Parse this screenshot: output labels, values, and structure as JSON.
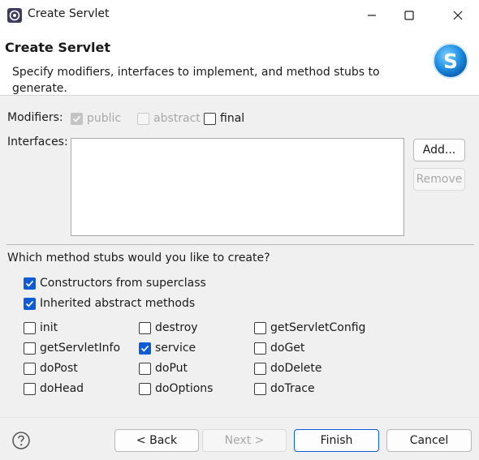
{
  "window": {
    "title": "Create Servlet",
    "icons": {
      "app": "eclipse-icon",
      "minimize": "minimize-icon",
      "maximize": "maximize-icon",
      "close": "close-icon"
    }
  },
  "header": {
    "title": "Create Servlet",
    "description": "Specify modifiers, interfaces to implement, and method stubs to generate.",
    "logo_letter": "S",
    "logo_icon": "servlet-logo-icon"
  },
  "modifiers": {
    "label": "Modifiers:",
    "options": [
      {
        "label": "public",
        "checked": true,
        "enabled": false
      },
      {
        "label": "abstract",
        "checked": false,
        "enabled": false
      },
      {
        "label": "final",
        "checked": false,
        "enabled": true
      }
    ]
  },
  "interfaces": {
    "label": "Interfaces:",
    "items": [],
    "add_label": "Add...",
    "remove_label": "Remove"
  },
  "stubs": {
    "question": "Which method stubs would you like to create?",
    "general": [
      {
        "label": "Constructors from superclass",
        "checked": true
      },
      {
        "label": "Inherited abstract methods",
        "checked": true
      }
    ],
    "methods": [
      {
        "label": "init",
        "checked": false
      },
      {
        "label": "destroy",
        "checked": false
      },
      {
        "label": "getServletConfig",
        "checked": false
      },
      {
        "label": "getServletInfo",
        "checked": false
      },
      {
        "label": "service",
        "checked": true
      },
      {
        "label": "doGet",
        "checked": false
      },
      {
        "label": "doPost",
        "checked": false
      },
      {
        "label": "doPut",
        "checked": false
      },
      {
        "label": "doDelete",
        "checked": false
      },
      {
        "label": "doHead",
        "checked": false
      },
      {
        "label": "doOptions",
        "checked": false
      },
      {
        "label": "doTrace",
        "checked": false
      }
    ]
  },
  "footer": {
    "help_icon": "help-icon",
    "back_label": "< Back",
    "next_label": "Next >",
    "finish_label": "Finish",
    "cancel_label": "Cancel"
  },
  "colors": {
    "accent": "#0b5cd6",
    "dialog_bg": "#f0f0f0"
  }
}
